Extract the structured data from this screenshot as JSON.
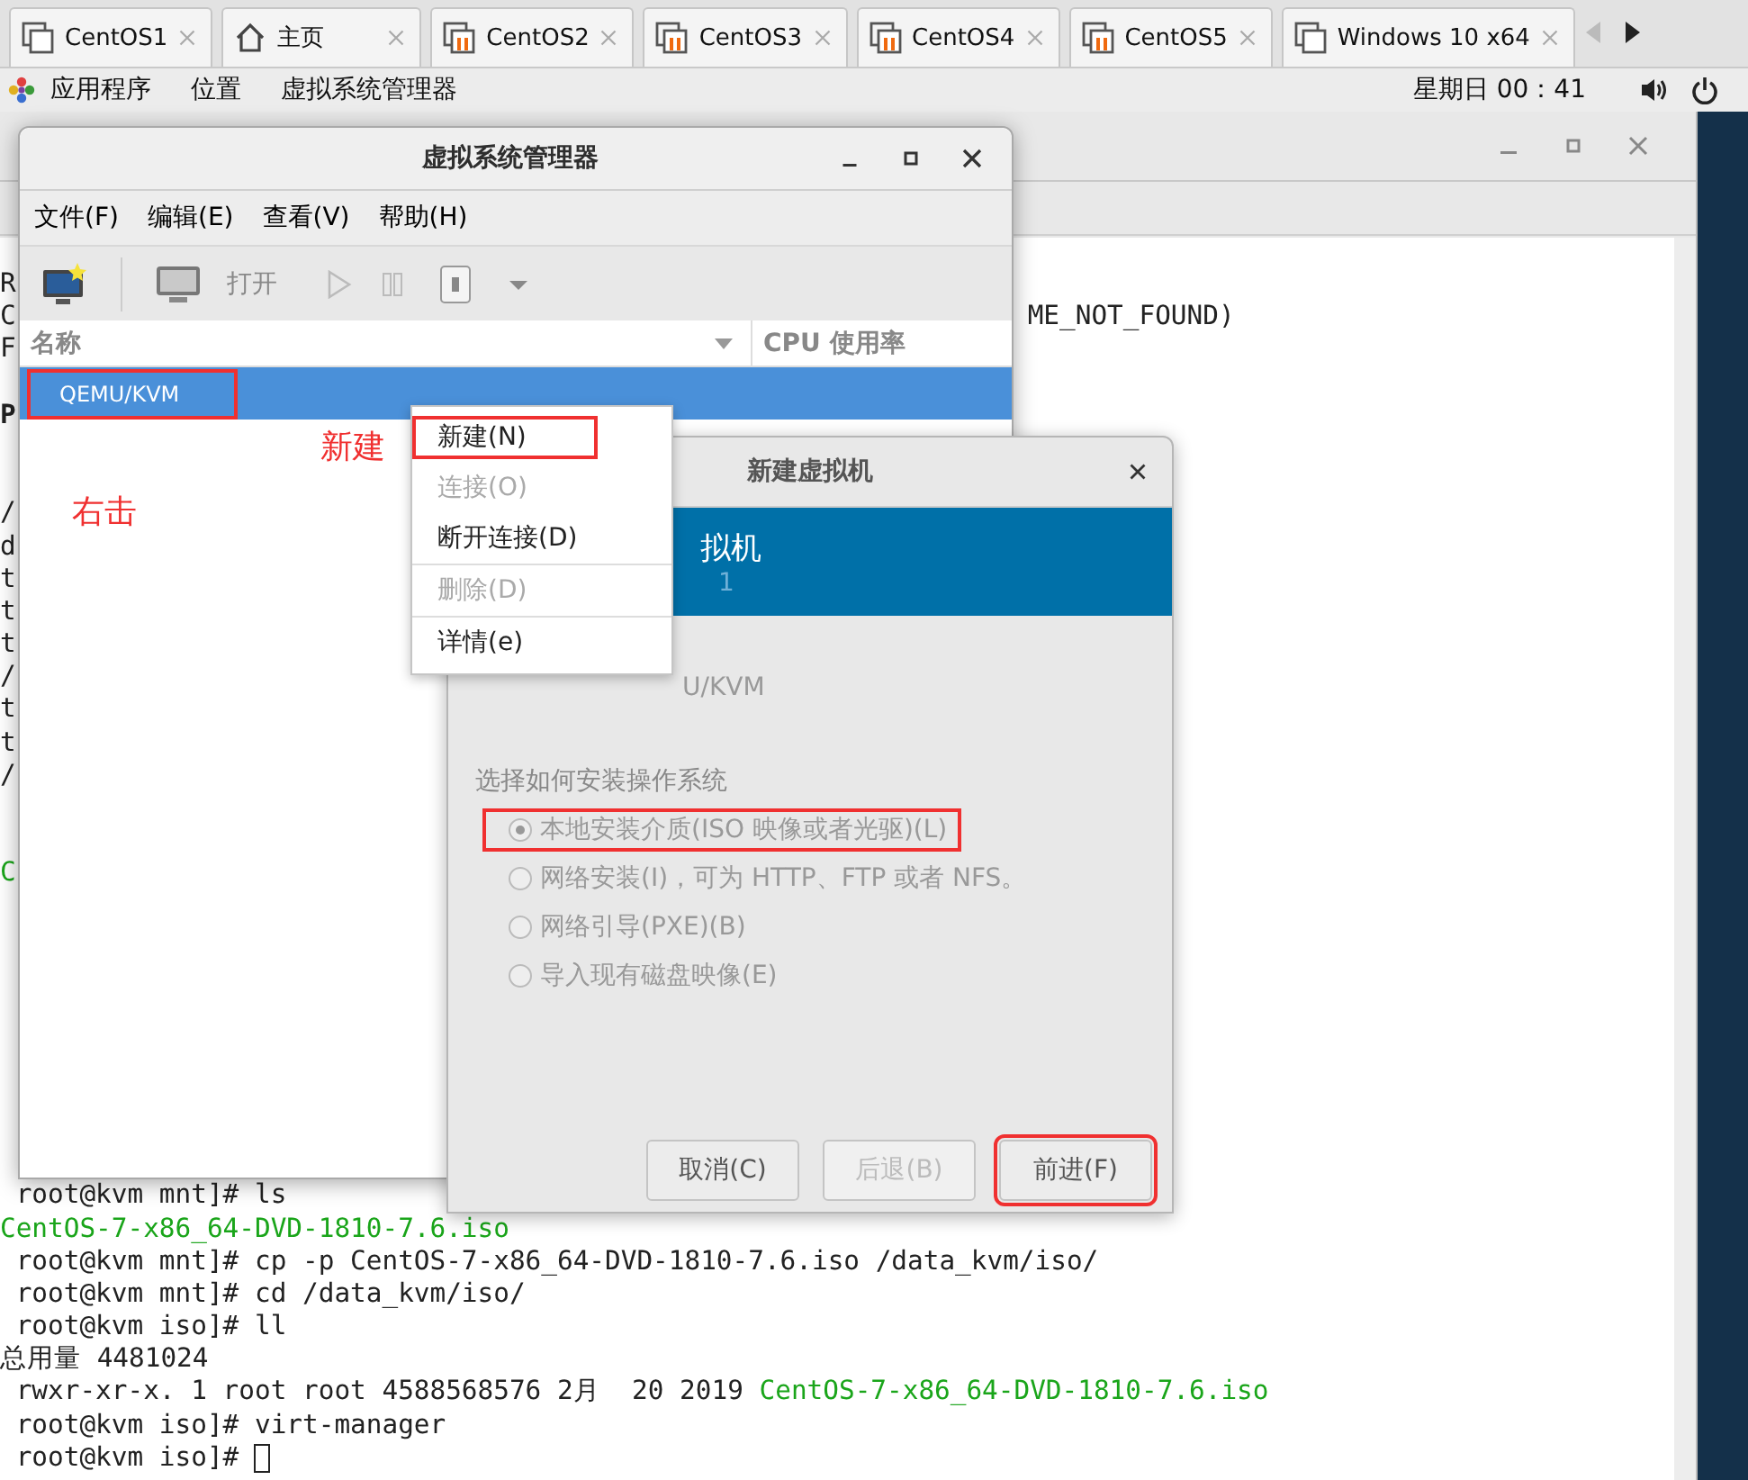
{
  "tabs": [
    {
      "label": "CentOS1",
      "kind": "stopped"
    },
    {
      "label": "主页",
      "kind": "home"
    },
    {
      "label": "CentOS2",
      "kind": "running"
    },
    {
      "label": "CentOS3",
      "kind": "running"
    },
    {
      "label": "CentOS4",
      "kind": "running"
    },
    {
      "label": "CentOS5",
      "kind": "running"
    },
    {
      "label": "Windows 10 x64",
      "kind": "stopped"
    }
  ],
  "top_bar": {
    "menus": [
      "应用程序",
      "位置",
      "虚拟系统管理器"
    ],
    "clock": "星期日 00：41"
  },
  "terminal": {
    "fragment_groups": [
      [
        {
          "text": "R"
        },
        {
          "text": "C",
          "tail": "ME_NOT_FOUND)"
        },
        {
          "text": "F"
        }
      ],
      [
        {
          "text": "P",
          "bold": true
        }
      ],
      [
        {
          "text": "/"
        },
        {
          "text": "d"
        },
        {
          "text": "t"
        },
        {
          "text": "t"
        },
        {
          "text": "t"
        },
        {
          "text": "/"
        },
        {
          "text": "t"
        },
        {
          "text": "t"
        },
        {
          "text": "/"
        }
      ],
      [
        {
          "text": "C",
          "green": true
        }
      ]
    ],
    "lines": [
      {
        "text": " root@kvm mnt]# ls"
      },
      {
        "text": "CentOS-7-x86_64-DVD-1810-7.6.iso",
        "green": true
      },
      {
        "text": " root@kvm mnt]# cp -p CentOS-7-x86_64-DVD-1810-7.6.iso /data_kvm/iso/"
      },
      {
        "text": " root@kvm mnt]# cd /data_kvm/iso/"
      },
      {
        "text": " root@kvm iso]# ll"
      },
      {
        "text": "总用量 4481024"
      },
      {
        "text": " rwxr-xr-x. 1 root root 4588568576 2月  20 2019 ",
        "green_tail": "CentOS-7-x86_64-DVD-1810-7.6.iso"
      },
      {
        "text": " root@kvm iso]# virt-manager"
      },
      {
        "text": " root@kvm iso]# ",
        "cursor": true
      }
    ]
  },
  "manager": {
    "title": "虚拟系统管理器",
    "menus": [
      "文件(F)",
      "编辑(E)",
      "查看(V)",
      "帮助(H)"
    ],
    "toolbar": {
      "open": "打开"
    },
    "columns": [
      "名称",
      "CPU 使用率"
    ],
    "rows": [
      {
        "name": "QEMU/KVM",
        "selected": true,
        "highlighted": true
      }
    ]
  },
  "annotations": [
    {
      "text": "新建",
      "kind": "new"
    },
    {
      "text": "右击",
      "kind": "right-click"
    }
  ],
  "context_menu": [
    {
      "label": "新建(N)",
      "disabled": false,
      "highlighted": true
    },
    {
      "label": "连接(O)",
      "disabled": true,
      "highlighted": false
    },
    {
      "label": "断开连接(D)",
      "disabled": false,
      "highlighted": false,
      "separator_after": true
    },
    {
      "label": "删除(D)",
      "disabled": true,
      "highlighted": false,
      "separator_after": true
    },
    {
      "label": "详情(e)",
      "disabled": false,
      "highlighted": false
    }
  ],
  "dialog": {
    "title": "新建虚拟机",
    "header": "拟机",
    "step": "1",
    "connection": "U/KVM",
    "prompt": "选择如何安装操作系统",
    "options": [
      {
        "label": "本地安装介质(ISO 映像或者光驱)(L)",
        "selected": true,
        "highlighted": true
      },
      {
        "label": "网络安装(I)，可为 HTTP、FTP 或者 NFS。",
        "selected": false,
        "highlighted": false
      },
      {
        "label": "网络引导(PXE)(B)",
        "selected": false,
        "highlighted": false
      },
      {
        "label": "导入现有磁盘映像(E)",
        "selected": false,
        "highlighted": false
      }
    ],
    "buttons": [
      {
        "label": "取消(C)",
        "disabled": false,
        "highlighted": false
      },
      {
        "label": "后退(B)",
        "disabled": true,
        "highlighted": false
      },
      {
        "label": "前进(F)",
        "disabled": false,
        "highlighted": true
      }
    ]
  }
}
